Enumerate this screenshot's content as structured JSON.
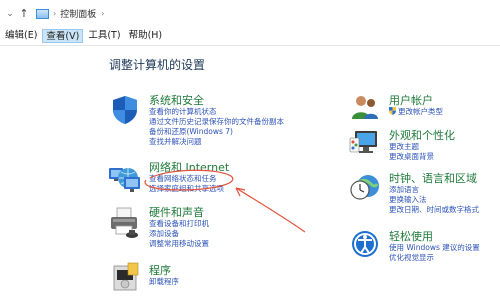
{
  "address_bar": {
    "separator": "›",
    "breadcrumb": "控制面板",
    "breadcrumb_sep": "›"
  },
  "menu": {
    "items": [
      {
        "label": "编辑(E)"
      },
      {
        "label": "查看(V)"
      },
      {
        "label": "工具(T)"
      },
      {
        "label": "帮助(H)"
      }
    ]
  },
  "page_title": "调整计算机的设置",
  "left_groups": {
    "system": {
      "title": "系统和安全",
      "links": [
        "查看你的计算机状态",
        "通过文件历史记录保存你的文件备份副本",
        "备份和还原(Windows 7)",
        "查找并解决问题"
      ]
    },
    "network": {
      "title": "网络和 Internet",
      "links": [
        "查看网络状态和任务",
        "选择家庭组和共享选项"
      ]
    },
    "hardware": {
      "title": "硬件和声音",
      "links": [
        "查看设备和打印机",
        "添加设备",
        "调整常用移动设置"
      ]
    },
    "programs": {
      "title": "程序",
      "links": [
        "卸载程序"
      ]
    }
  },
  "right_groups": {
    "user": {
      "title": "用户帐户",
      "links": [
        "更改帐户类型"
      ]
    },
    "appearance": {
      "title": "外观和个性化",
      "links": [
        "更改主题",
        "更改桌面背景"
      ]
    },
    "clock": {
      "title": "时钟、语言和区域",
      "links": [
        "添加语言",
        "更换输入法",
        "更改日期、时间或数字格式"
      ]
    },
    "ease": {
      "title": "轻松使用",
      "links": [
        "使用 Windows 建议的设置",
        "优化视觉显示"
      ]
    }
  },
  "colors": {
    "group_title": "#1f7a3a",
    "link": "#2d53b8",
    "annotation": "#e0533b",
    "menu_active_bg": "#cce4f7"
  },
  "icons": {
    "system": "shield-icon",
    "network": "network-icon",
    "hardware": "printer-icon",
    "programs": "program-box-icon",
    "user": "users-icon",
    "appearance": "paint-monitor-icon",
    "clock": "clock-globe-icon",
    "ease": "accessibility-icon"
  }
}
